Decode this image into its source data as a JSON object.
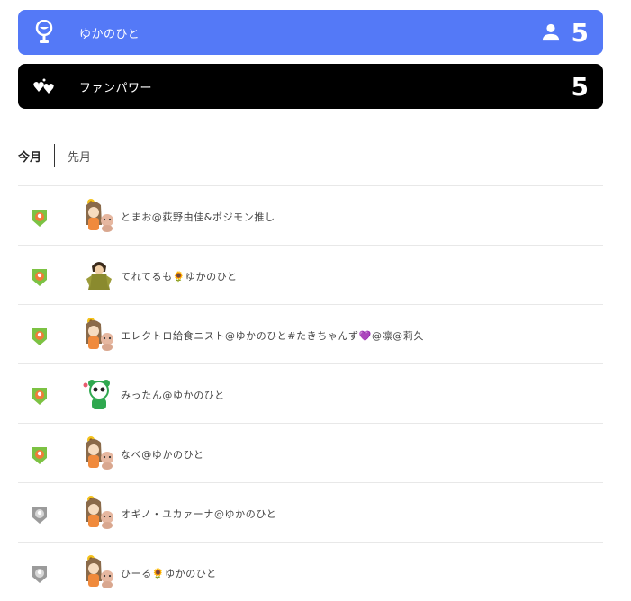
{
  "header": {
    "supporter_bar": {
      "label": "ゆかのひと",
      "count": "5",
      "icon": "microphone-stand-icon"
    },
    "fanpower_bar": {
      "label": "ファンパワー",
      "count": "5",
      "icon": "hearts-icon"
    }
  },
  "tabs": [
    {
      "label": "今月",
      "active": true
    },
    {
      "label": "先月",
      "active": false
    }
  ],
  "colors": {
    "accent_blue": "#5479f7",
    "black_bar": "#000000",
    "badge_green": "#7cc243",
    "badge_gray": "#9b9b9b"
  },
  "fans": [
    {
      "name": "とまお@荻野由佳&ポジモン推し",
      "badge": "green-rank-badge-icon",
      "avatar": "girl-with-dog-avatar"
    },
    {
      "name": "てれてるも🌻ゆかのひと",
      "badge": "green-rank-badge-icon",
      "avatar": "warrior-character-avatar"
    },
    {
      "name": "エレクトロ給食ニスト@ゆかのひと#たきちゃんず💜@凛@莉久",
      "badge": "green-rank-badge-icon",
      "avatar": "girl-with-dog-avatar"
    },
    {
      "name": "みったん@ゆかのひと",
      "badge": "green-rank-badge-icon",
      "avatar": "panda-mascot-avatar"
    },
    {
      "name": "なべ@ゆかのひと",
      "badge": "green-rank-badge-icon",
      "avatar": "girl-with-dog-avatar"
    },
    {
      "name": "オギノ・ユカァーナ@ゆかのひと",
      "badge": "gray-rank-badge-icon",
      "avatar": "girl-with-dog-avatar"
    },
    {
      "name": "ひーる🌻ゆかのひと",
      "badge": "gray-rank-badge-icon",
      "avatar": "girl-with-dog-avatar"
    }
  ]
}
